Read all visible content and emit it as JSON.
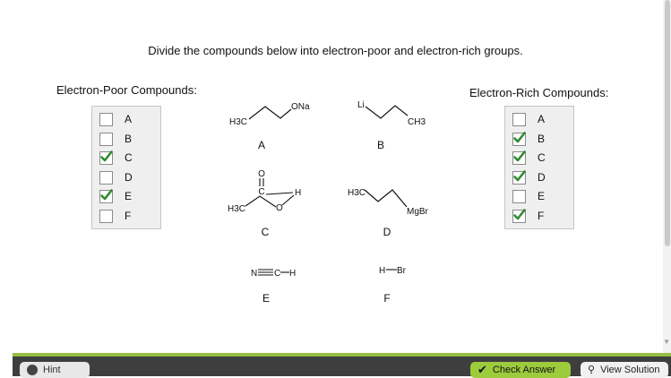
{
  "instruction": "Divide the compounds below into electron-poor and electron-rich groups.",
  "poor_group": {
    "title": "Electron-Poor Compounds:",
    "items": [
      {
        "letter": "A",
        "checked": false
      },
      {
        "letter": "B",
        "checked": false
      },
      {
        "letter": "C",
        "checked": true
      },
      {
        "letter": "D",
        "checked": false
      },
      {
        "letter": "E",
        "checked": true
      },
      {
        "letter": "F",
        "checked": false
      }
    ]
  },
  "rich_group": {
    "title": "Electron-Rich Compounds:",
    "items": [
      {
        "letter": "A",
        "checked": false
      },
      {
        "letter": "B",
        "checked": true
      },
      {
        "letter": "C",
        "checked": true
      },
      {
        "letter": "D",
        "checked": true
      },
      {
        "letter": "E",
        "checked": false
      },
      {
        "letter": "F",
        "checked": true
      }
    ]
  },
  "compounds": {
    "A": {
      "label": "A",
      "left_group": "H3C",
      "right_group": "ONa"
    },
    "B": {
      "label": "B",
      "left_group": "Li",
      "right_group": "CH3"
    },
    "C": {
      "label": "C",
      "o_top": "O",
      "c_mid": "C",
      "h": "H",
      "left_group": "H3C",
      "o_bottom": "O"
    },
    "D": {
      "label": "D",
      "left_group": "H3C",
      "right_group": "MgBr"
    },
    "E": {
      "label": "E",
      "n": "N",
      "c": "C",
      "h": "H"
    },
    "F": {
      "label": "F",
      "h": "H",
      "br": "Br"
    }
  },
  "footer": {
    "hint_label": "Hint",
    "check_label": "Check Answer",
    "solution_label": "View Solution"
  },
  "colors": {
    "accent_green": "#98bd45",
    "check_green": "#2e8b2e",
    "footer_dark": "#3e3e3e"
  }
}
